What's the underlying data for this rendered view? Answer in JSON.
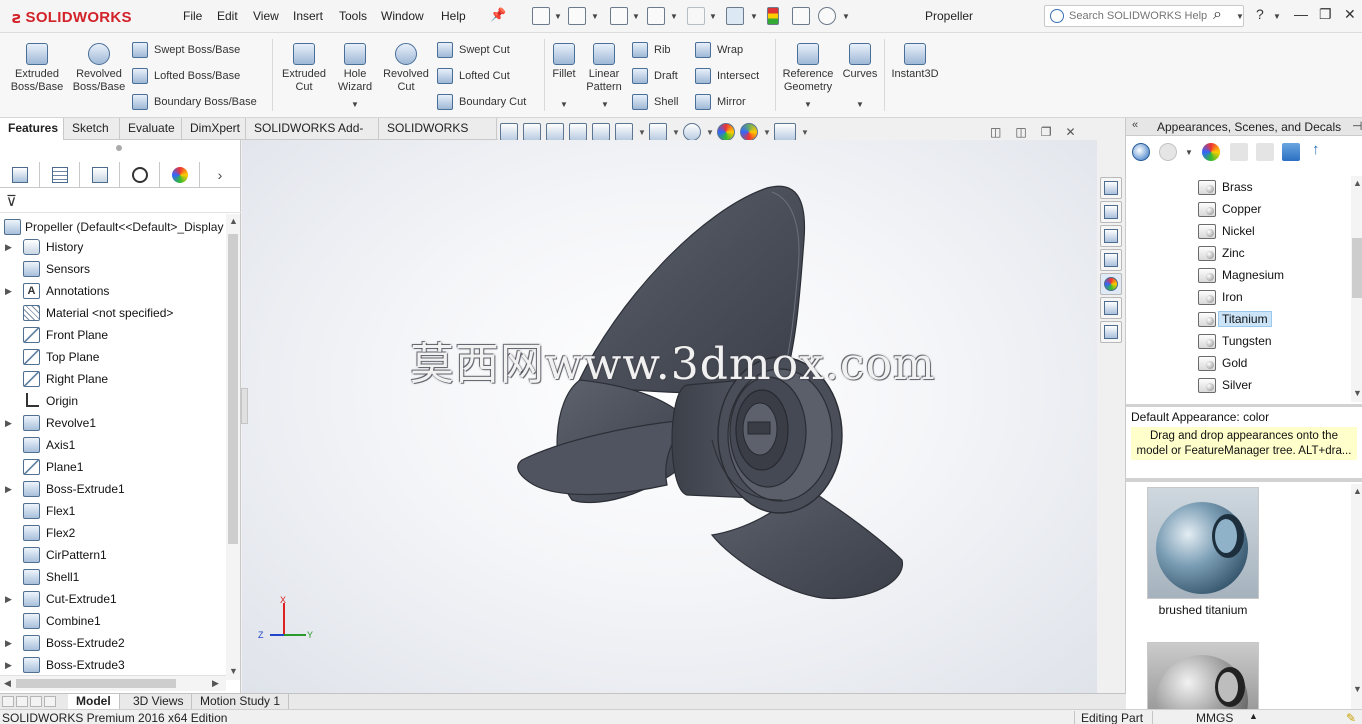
{
  "app": {
    "logo": "SOLIDWORKS",
    "menu": [
      "File",
      "Edit",
      "View",
      "Insert",
      "Tools",
      "Window",
      "Help"
    ],
    "document_title": "Propeller",
    "help_search_placeholder": "Search SOLIDWORKS Help"
  },
  "command_manager": {
    "large": [
      {
        "label": "Extruded\nBoss/Base"
      },
      {
        "label": "Revolved\nBoss/Base"
      },
      {
        "label": "Extruded\nCut"
      },
      {
        "label": "Hole\nWizard"
      },
      {
        "label": "Revolved\nCut"
      },
      {
        "label": "Fillet"
      },
      {
        "label": "Linear\nPattern"
      },
      {
        "label": "Reference\nGeometry"
      },
      {
        "label": "Curves"
      },
      {
        "label": "Instant3D"
      }
    ],
    "small_boss": [
      "Swept Boss/Base",
      "Lofted Boss/Base",
      "Boundary Boss/Base"
    ],
    "small_cut": [
      "Swept Cut",
      "Lofted Cut",
      "Boundary Cut"
    ],
    "small_features_a": [
      "Rib",
      "Draft",
      "Shell"
    ],
    "small_features_b": [
      "Wrap",
      "Intersect",
      "Mirror"
    ]
  },
  "tabs": [
    "Features",
    "Sketch",
    "Evaluate",
    "DimXpert",
    "SOLIDWORKS Add-Ins",
    "SOLIDWORKS MBD"
  ],
  "active_tab": "Features",
  "feature_tree": {
    "root": "Propeller  (Default<<Default>_Display",
    "items": [
      {
        "label": "History",
        "icon": "history-icon",
        "expandable": true
      },
      {
        "label": "Sensors",
        "icon": "sensors-icon",
        "expandable": false
      },
      {
        "label": "Annotations",
        "icon": "annotations-icon",
        "expandable": true
      },
      {
        "label": "Material <not specified>",
        "icon": "material-icon",
        "expandable": false
      },
      {
        "label": "Front Plane",
        "icon": "plane-icon",
        "expandable": false
      },
      {
        "label": "Top Plane",
        "icon": "plane-icon",
        "expandable": false
      },
      {
        "label": "Right Plane",
        "icon": "plane-icon",
        "expandable": false
      },
      {
        "label": "Origin",
        "icon": "origin-icon",
        "expandable": false
      },
      {
        "label": "Revolve1",
        "icon": "revolve-icon",
        "expandable": true
      },
      {
        "label": "Axis1",
        "icon": "axis-icon",
        "expandable": false
      },
      {
        "label": "Plane1",
        "icon": "plane-icon",
        "expandable": false
      },
      {
        "label": "Boss-Extrude1",
        "icon": "extrude-icon",
        "expandable": true
      },
      {
        "label": "Flex1",
        "icon": "flex-icon",
        "expandable": false
      },
      {
        "label": "Flex2",
        "icon": "flex-icon",
        "expandable": false
      },
      {
        "label": "CirPattern1",
        "icon": "pattern-icon",
        "expandable": false
      },
      {
        "label": "Shell1",
        "icon": "shell-icon",
        "expandable": false
      },
      {
        "label": "Cut-Extrude1",
        "icon": "cut-icon",
        "expandable": true
      },
      {
        "label": "Combine1",
        "icon": "combine-icon",
        "expandable": false
      },
      {
        "label": "Boss-Extrude2",
        "icon": "extrude-icon",
        "expandable": true
      },
      {
        "label": "Boss-Extrude3",
        "icon": "extrude-icon",
        "expandable": true
      }
    ]
  },
  "graphics": {
    "watermark": "莫西网www.3dmox.com",
    "triad": {
      "x": "X",
      "y": "Y",
      "z": "Z"
    }
  },
  "appearances": {
    "title": "Appearances, Scenes, and Decals",
    "folders": [
      "Brass",
      "Copper",
      "Nickel",
      "Zinc",
      "Magnesium",
      "Iron",
      "Titanium",
      "Tungsten",
      "Gold",
      "Silver"
    ],
    "selected": "Titanium",
    "default_appearance": "Default Appearance: color",
    "hint_line1": "Drag and drop appearances onto the",
    "hint_line2": "model or FeatureManager tree.  ALT+dra...",
    "swatch1_label": "brushed titanium"
  },
  "model_tabs": [
    "Model",
    "3D Views",
    "Motion Study 1"
  ],
  "status": {
    "edition": "SOLIDWORKS Premium 2016 x64 Edition",
    "mode": "Editing Part",
    "units": "MMGS"
  },
  "colors": {
    "brand_red": "#d2232a",
    "model_gray": "#4d525d",
    "hint_yellow": "#ffffcc",
    "selection_blue": "#cce4f7"
  }
}
